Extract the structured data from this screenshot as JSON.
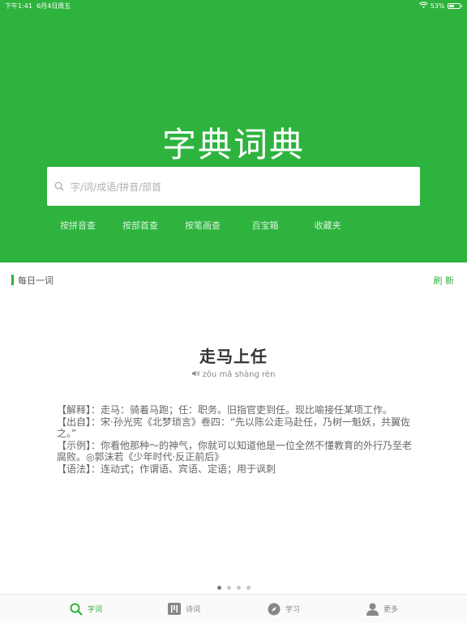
{
  "status_bar": {
    "time": "下午1:41",
    "date": "6月4日周五",
    "battery": "53%",
    "battery_level": 0.53
  },
  "app_title": "字典词典",
  "search": {
    "placeholder": "字/词/成语/拼音/部首"
  },
  "quick_links": [
    "按拼音查",
    "按部首查",
    "按笔画查",
    "百宝箱",
    "收藏夹"
  ],
  "daily": {
    "section_title": "每日一词",
    "refresh_label": "刷 新",
    "word": "走马上任",
    "pinyin": "zǒu mǎ shàng rèn",
    "entries": [
      "【解释】：走马：骑着马跑；任：职务。旧指官吏到任。现比喻接任某项工作。",
      "【出自】：宋·孙光宪《北梦琐言》卷四：“先以陈公走马赴任，乃树一魁妖，共翼佐之。”",
      "【示例】：你看他那种～的神气，你就可以知道他是一位全然不懂教育的外行乃至老腐败。◎郭沫若《少年时代·反正前后》",
      "【语法】：连动式；作谓语、宾语、定语；用于讽刺"
    ]
  },
  "pagination": {
    "count": 4,
    "active_index": 0
  },
  "tabs": [
    {
      "label": "字词",
      "icon": "search-icon",
      "active": true
    },
    {
      "label": "诗词",
      "icon": "book-icon",
      "active": false
    },
    {
      "label": "学习",
      "icon": "compass-icon",
      "active": false
    },
    {
      "label": "更多",
      "icon": "person-icon",
      "active": false
    }
  ],
  "colors": {
    "brand_green": "#2eb33e",
    "text_dark": "#333333",
    "text_muted": "#666666"
  }
}
